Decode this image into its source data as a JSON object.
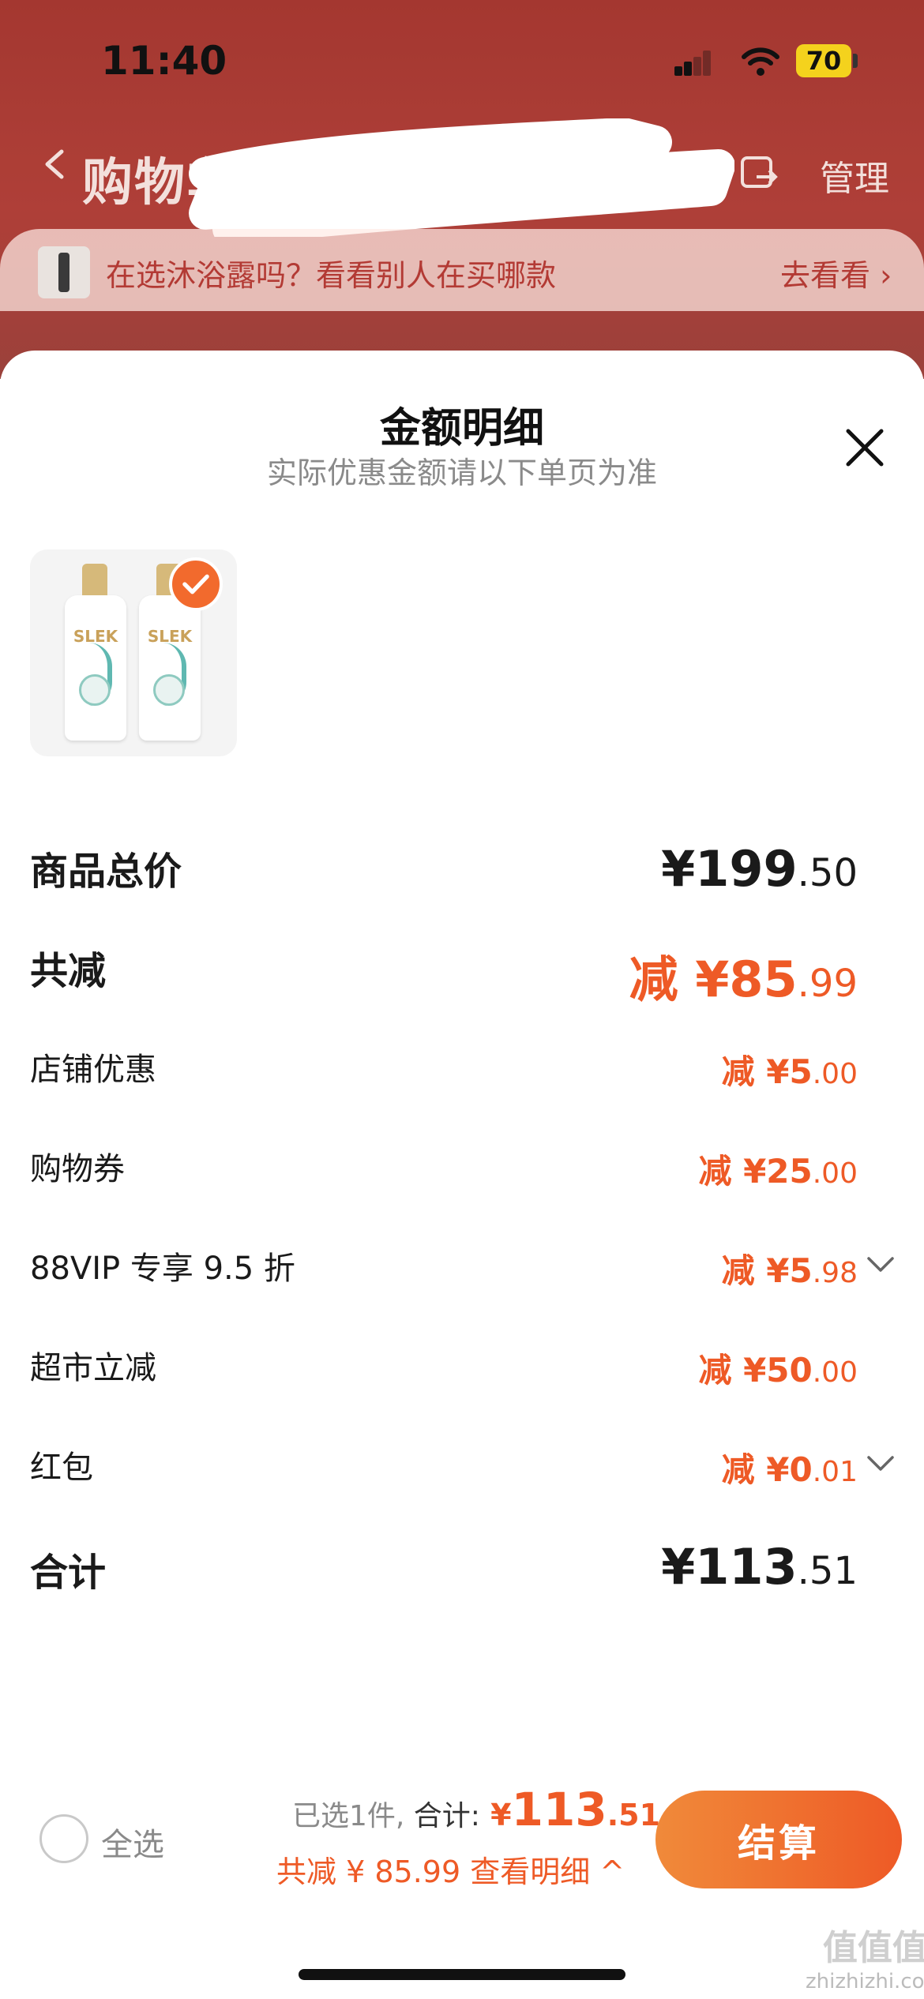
{
  "status_bar": {
    "time": "11:40",
    "battery": "70"
  },
  "nav": {
    "title": "购物车",
    "manage": "管理"
  },
  "promo": {
    "text": "在选沐浴露吗？看看别人在买哪款",
    "link": "去看看 ›"
  },
  "sheet": {
    "title": "金额明细",
    "subtitle": "实际优惠金额请以下单页为准",
    "product": {
      "brand": "SLEK"
    },
    "rows": [
      {
        "label": "商品总价",
        "prefix": "",
        "integer": "¥199",
        "decimal": ".50"
      },
      {
        "label": "共减",
        "prefix": "减 ",
        "integer": "¥85",
        "decimal": ".99"
      },
      {
        "label": "店铺优惠",
        "prefix": "减 ",
        "integer": "¥5",
        "decimal": ".00"
      },
      {
        "label": "购物券",
        "prefix": "减 ",
        "integer": "¥25",
        "decimal": ".00"
      },
      {
        "label": "88VIP 专享 9.5 折",
        "prefix": "减 ",
        "integer": "¥5",
        "decimal": ".98"
      },
      {
        "label": "超市立减",
        "prefix": "减 ",
        "integer": "¥50",
        "decimal": ".00"
      },
      {
        "label": "红包",
        "prefix": "减 ",
        "integer": "¥0",
        "decimal": ".01"
      },
      {
        "label": "合计",
        "prefix": "",
        "integer": "¥113",
        "decimal": ".51"
      }
    ]
  },
  "bottom_bar": {
    "select_all": "全选",
    "selected_count": "已选1件,",
    "total_label": " 合计:",
    "total_currency": " ¥",
    "total_integer": "113",
    "total_decimal": ".51",
    "saving": "共减 ¥ 85.99  查看明细 ^",
    "checkout": "结算"
  },
  "watermark": {
    "main": "值值值",
    "sub": "zhizhizhi.com"
  },
  "colors": {
    "accent": "#ee5a26",
    "header_bg": "#b33b33"
  }
}
